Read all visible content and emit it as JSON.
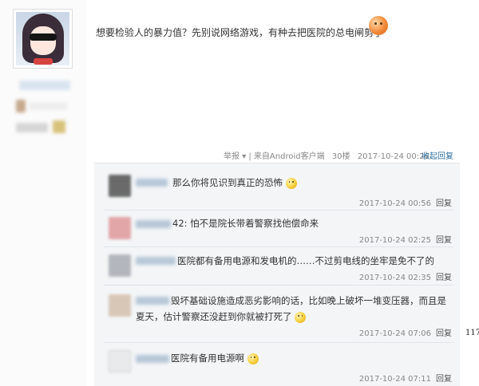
{
  "post": {
    "text": "想要检验人的暴力值？先别说网络游戏，有种去把医院的总电闸剪了",
    "report_label": "举报",
    "source": "来自Android客户端",
    "floor": "30楼",
    "date": "2017-10-24 00:26",
    "collapse_label": "收起回复"
  },
  "comments": [
    {
      "text": "那么你将见识到真正的恐怖",
      "date": "2017-10-24 00:56",
      "reply_label": "回复"
    },
    {
      "text": "42: 怕不是院长带着警察找他偿命来",
      "date": "2017-10-24 02:25",
      "reply_label": "回复"
    },
    {
      "text": "医院都有备用电源和发电机的……不过剪电线的坐牢是免不了的",
      "date": "2017-10-24 02:35",
      "reply_label": "回复"
    },
    {
      "text": "毁坏基础设施造成恶劣影响的话，比如晚上破坏一堆变压器，而且是夏天，估计警察还没赶到你就被打死了",
      "date": "2017-10-24 07:06",
      "reply_label": "回复"
    },
    {
      "text": "医院有备用电源啊",
      "date": "2017-10-24 07:11",
      "reply_label": "回复"
    }
  ],
  "page_edge_number": "117",
  "icons": {
    "avatar": "anime-avatar-sunglasses",
    "post_emoji": "angry-face-icon",
    "comment_emoji": "smile-face-icon"
  },
  "colors": {
    "link": "#2f6ea3",
    "meta": "#888888",
    "panel_bg": "#f3f5f7"
  }
}
